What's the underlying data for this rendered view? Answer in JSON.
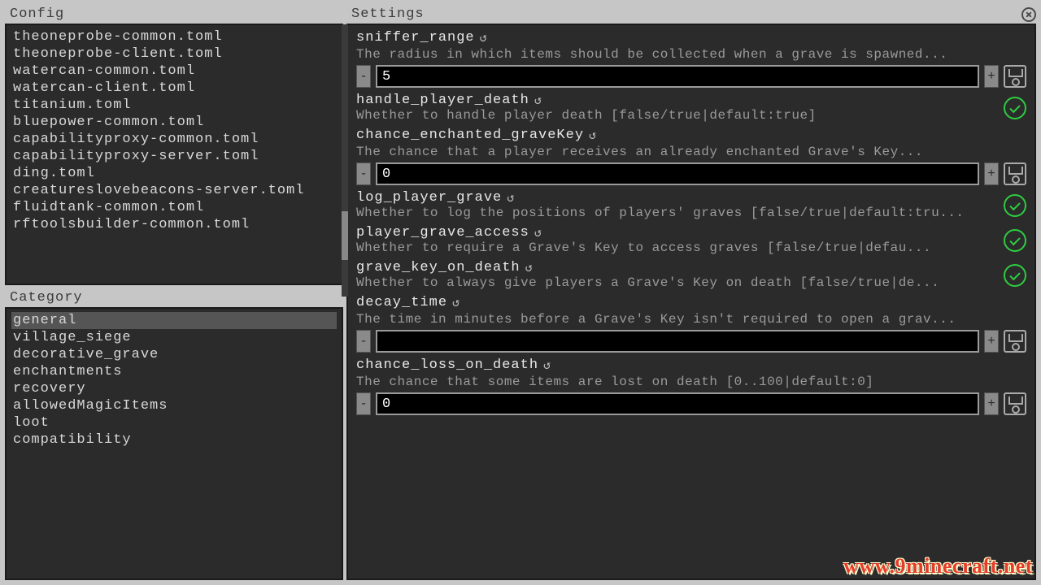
{
  "config": {
    "header": "Config",
    "items": [
      "theoneprobe-common.toml",
      "theoneprobe-client.toml",
      "watercan-common.toml",
      "watercan-client.toml",
      "titanium.toml",
      "bluepower-common.toml",
      "capabilityproxy-common.toml",
      "capabilityproxy-server.toml",
      "ding.toml",
      "creatureslovebeacons-server.toml",
      "fluidtank-common.toml",
      "rftoolsbuilder-common.toml"
    ]
  },
  "category": {
    "header": "Category",
    "items": [
      "general",
      "village_siege",
      "decorative_grave",
      "enchantments",
      "recovery",
      "allowedMagicItems",
      "loot",
      "compatibility"
    ],
    "selected": "general"
  },
  "settings": {
    "header": "Settings",
    "items": [
      {
        "key": "sniffer_range",
        "desc": "The radius in which items should be collected when a grave is spawned...",
        "type": "number",
        "value": "5"
      },
      {
        "key": "handle_player_death",
        "desc": "Whether to handle player death [false/true|default:true]",
        "type": "bool"
      },
      {
        "key": "chance_enchanted_graveKey",
        "desc": "The chance that a player receives an already enchanted Grave's Key...",
        "type": "number",
        "value": "0"
      },
      {
        "key": "log_player_grave",
        "desc": "Whether to log the positions of players' graves [false/true|default:tru...",
        "type": "bool"
      },
      {
        "key": "player_grave_access",
        "desc": "Whether to require a Grave's Key to access graves [false/true|defau...",
        "type": "bool"
      },
      {
        "key": "grave_key_on_death",
        "desc": "Whether to always give players a Grave's Key on death [false/true|de...",
        "type": "bool"
      },
      {
        "key": "decay_time",
        "desc": "The time in minutes before a Grave's Key isn't required to open a grav...",
        "type": "number",
        "value": ""
      },
      {
        "key": "chance_loss_on_death",
        "desc": "The chance that some items are lost on death [0..100|default:0]",
        "type": "number",
        "value": "0"
      }
    ]
  },
  "glyphs": {
    "reset": "↺",
    "minus": "-",
    "plus": "+"
  },
  "watermark": "www.9minecraft.net"
}
